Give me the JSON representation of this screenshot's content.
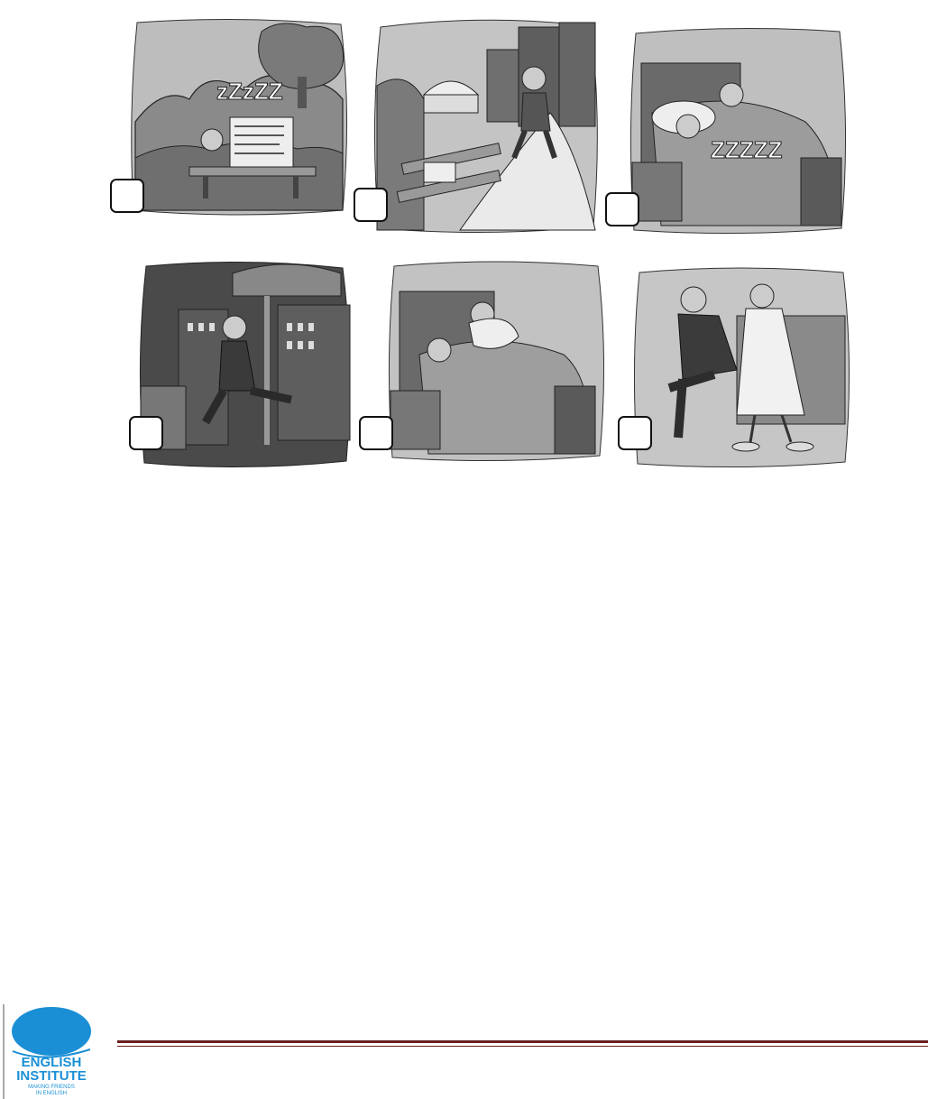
{
  "worksheet": {
    "panels": [
      {
        "scene": "man sleeping on park bench under newspapers",
        "number": ""
      },
      {
        "scene": "man jogging past bench in park",
        "number": ""
      },
      {
        "scene": "couple sleeping in bed",
        "number": ""
      },
      {
        "scene": "man running on city street",
        "number": ""
      },
      {
        "scene": "woman waking man in bed",
        "number": ""
      },
      {
        "scene": "man putting on shoes while woman holds him",
        "number": ""
      }
    ]
  },
  "footer": {
    "logo": {
      "line1": "ENGLISH",
      "line2": "INSTITUTE",
      "tagline1": "MAKING FRIENDS",
      "tagline2": "IN ENGLISH",
      "color": "#1a8fd6"
    },
    "rule_color": "#6b1f1f"
  }
}
